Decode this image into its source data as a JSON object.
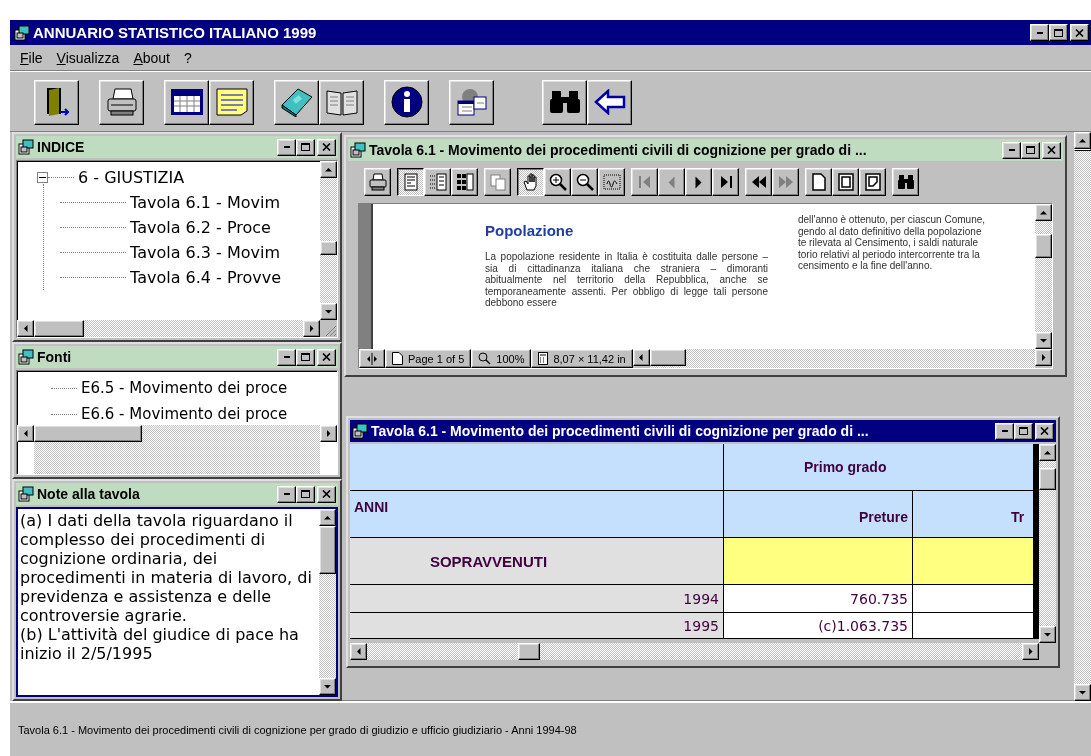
{
  "window": {
    "title": "ANNUARIO STATISTICO ITALIANO 1999"
  },
  "menu": [
    "File",
    "Visualizza",
    "About",
    "?"
  ],
  "toolbar": [
    [
      {
        "kind": "exit"
      }
    ],
    [
      {
        "kind": "print"
      }
    ],
    [
      {
        "kind": "table"
      },
      {
        "kind": "note"
      }
    ],
    [
      {
        "kind": "book"
      },
      {
        "kind": "open-book"
      }
    ],
    [
      {
        "kind": "info"
      }
    ],
    [
      {
        "kind": "calendar"
      }
    ],
    [
      {
        "kind": "search"
      },
      {
        "kind": "back"
      }
    ]
  ],
  "indice": {
    "title": "INDICE",
    "active": false,
    "tree": [
      {
        "label": "6 - GIUSTIZIA",
        "expanded": true,
        "children": [
          {
            "label": "Tavola 6.1 - Movim"
          },
          {
            "label": "Tavola 6.2 - Proce"
          },
          {
            "label": "Tavola 6.3 - Movim"
          },
          {
            "label": "Tavola 6.4 - Provve"
          }
        ]
      }
    ]
  },
  "fonti": {
    "title": "Fonti",
    "active": false,
    "items": [
      "E6.5 - Movimento dei proce",
      "E6.6 - Movimento dei proce"
    ]
  },
  "note": {
    "title": "Note alla tavola",
    "active": false,
    "paragraphs": [
      "(a) I dati della tavola riguardano il complesso dei procedimenti di cognizione ordinaria, dei procedimenti in materia di lavoro, di previdenza e assistenza e delle controversie agrarie.",
      "(b) L'attività del giudice di pace ha inizio il 2/5/1995"
    ]
  },
  "viewer": {
    "title": "Tavola 6.1 - Movimento dei procedimenti civili di cognizione per grado di ...",
    "active": false,
    "tools": [
      [
        {
          "kind": "print",
          "pressed": false,
          "disabled": false
        }
      ],
      [
        {
          "kind": "single-page",
          "pressed": true,
          "disabled": false
        },
        {
          "kind": "list-page",
          "pressed": false,
          "disabled": false
        },
        {
          "kind": "thumbnails",
          "pressed": false,
          "disabled": false
        }
      ],
      [
        {
          "kind": "copy",
          "pressed": false,
          "disabled": true
        }
      ],
      [
        {
          "kind": "hand",
          "pressed": true,
          "disabled": false
        },
        {
          "kind": "zoom-in",
          "pressed": false,
          "disabled": false
        },
        {
          "kind": "zoom-out",
          "pressed": false,
          "disabled": false
        },
        {
          "kind": "text-select",
          "pressed": false,
          "disabled": false
        }
      ],
      [
        {
          "kind": "first",
          "pressed": false,
          "disabled": true
        },
        {
          "kind": "prev",
          "pressed": false,
          "disabled": true
        },
        {
          "kind": "next",
          "pressed": false,
          "disabled": false
        },
        {
          "kind": "last",
          "pressed": false,
          "disabled": false
        }
      ],
      [
        {
          "kind": "back",
          "pressed": false,
          "disabled": false
        },
        {
          "kind": "forward",
          "pressed": false,
          "disabled": true
        }
      ],
      [
        {
          "kind": "page",
          "pressed": false,
          "disabled": false
        },
        {
          "kind": "page-frame",
          "pressed": false,
          "disabled": false
        },
        {
          "kind": "page-fold",
          "pressed": false,
          "disabled": false
        }
      ],
      [
        {
          "kind": "find",
          "pressed": false,
          "disabled": false
        }
      ]
    ],
    "page": {
      "heading": "Popolazione",
      "column_1": "La popolazione residente in Italia è costituita dalle persone – sia di cittadinanza italiana che straniera – dimoranti abitualmente nel territorio della Repubblica, anche se temporaneamente assenti. Per obbligo di legge tali persone debbono essere",
      "column_2": [
        "dell'anno è ottenuto, per ciascun Comune,",
        "gendo al dato definitivo della popolazione",
        "te rilevata al Censimento, i saldi naturale",
        "torio relativi al periodo intercorrente tra la",
        "censimento e la fine dell'anno."
      ]
    },
    "status": {
      "page": "Page 1 of 5",
      "zoom": "100%",
      "size": "8,07 × 11,42 in"
    }
  },
  "table_window": {
    "title": "Tavola 6.1 - Movimento dei procedimenti civili di cognizione per grado di ...",
    "active": true,
    "table": {
      "group_header": "Primo grado",
      "row_header": "ANNI",
      "columns": [
        "Preture",
        "Tr"
      ],
      "section": "SOPRAVVENUTI",
      "rows": [
        {
          "year": "1994",
          "values": [
            "760.735"
          ]
        },
        {
          "year": "1995",
          "values": [
            "(c)1.063.735"
          ]
        }
      ]
    }
  },
  "status_bar": "Tavola 6.1 - Movimento dei procedimenti civili di cognizione per grado di giudizio e ufficio giudiziario - Anni 1994-98"
}
